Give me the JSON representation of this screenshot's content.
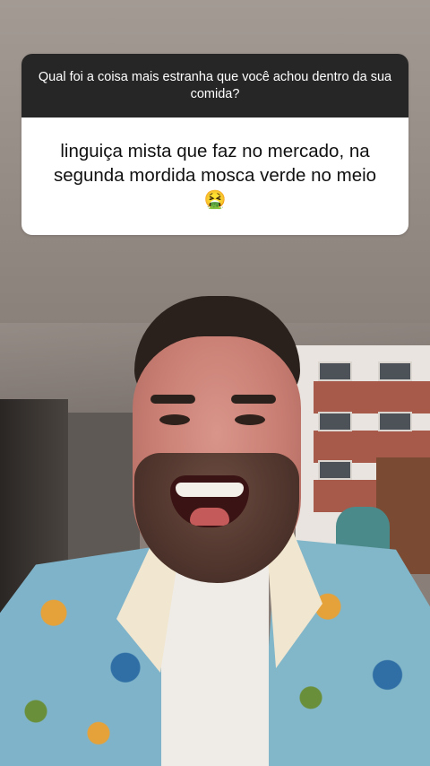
{
  "question_card": {
    "question": "Qual foi a coisa mais estranha que você achou dentro da sua comida?",
    "answer": "linguiça mista que faz no mercado,  na segunda mordida mosca verde no meio",
    "answer_emoji": "🤮",
    "header_color": "#262626",
    "body_color": "#ffffff"
  },
  "background": {
    "icon_names": [
      "nauseated-face-emoji"
    ]
  }
}
